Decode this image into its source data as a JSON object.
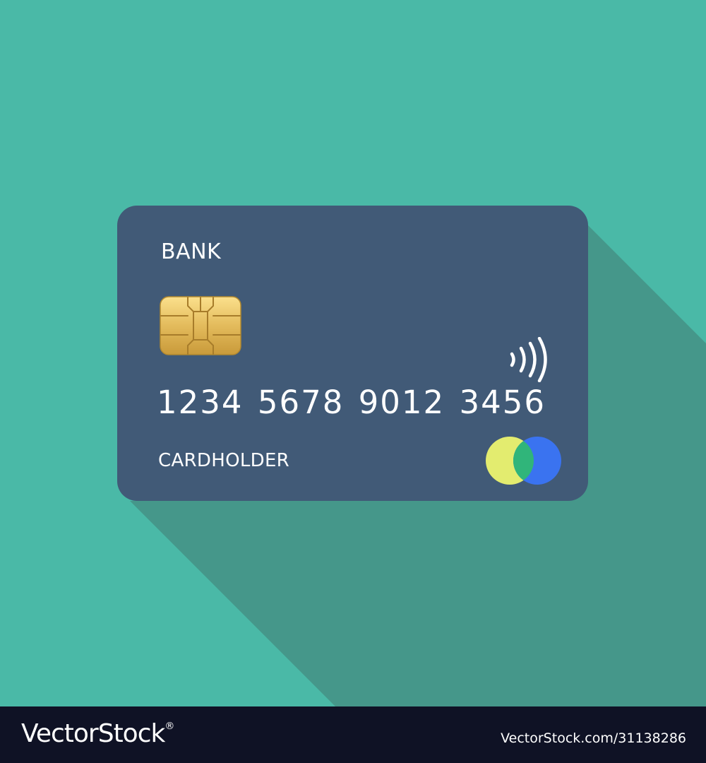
{
  "colors": {
    "background": "#4ab9a7",
    "long_shadow": "#45978a",
    "card": "#415a77",
    "text": "#ffffff",
    "chip_gold": "#d6ab44",
    "brand_yellow": "#e3ec6f",
    "brand_blue": "#3a73f0",
    "brand_overlap": "#30b57a",
    "footer": "#0f1225"
  },
  "card": {
    "bank_name": "BANK",
    "number": "1234 5678 9012 3456",
    "cardholder": "CARDHOLDER",
    "chip_icon": "emv-chip-icon",
    "contactless_icon": "contactless-wave-icon",
    "brand_icon": "two-circle-card-brand-icon"
  },
  "footer": {
    "logo": "VectorStock",
    "logo_mark": "®",
    "url": "VectorStock.com/31138286"
  }
}
